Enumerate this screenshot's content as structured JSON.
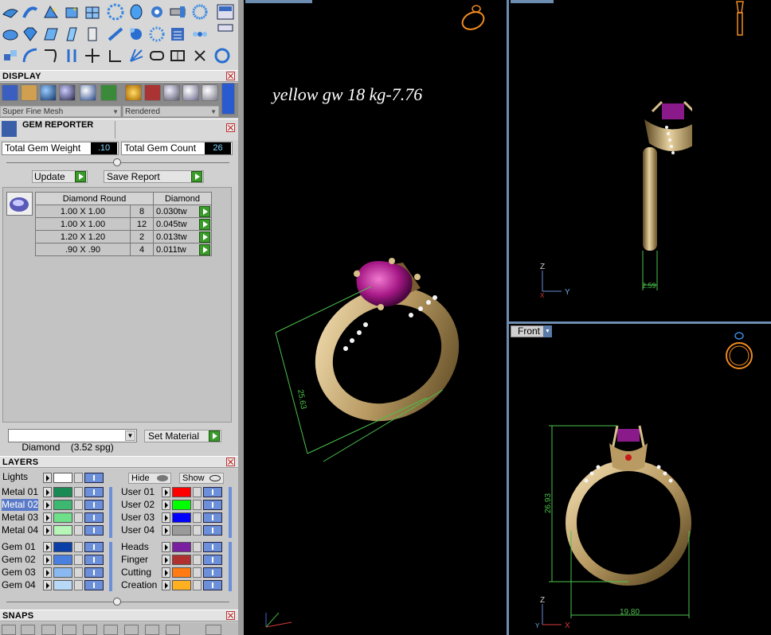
{
  "display": {
    "title": "DISPLAY",
    "mesh_mode": "Super Fine Mesh",
    "render_mode": "Rendered"
  },
  "gem_reporter": {
    "title": "GEM REPORTER",
    "total_weight_label": "Total Gem Weight",
    "total_weight_value": ".10",
    "total_count_label": "Total Gem Count",
    "total_count_value": "26",
    "update_label": "Update",
    "save_report_label": "Save Report",
    "table_headers": [
      "Diamond Round",
      "Diamond"
    ],
    "rows": [
      {
        "size": "1.00 X 1.00",
        "count": "8",
        "weight": "0.030tw"
      },
      {
        "size": "1.00 X 1.00",
        "count": "12",
        "weight": "0.045tw"
      },
      {
        "size": "1.20 X 1.20",
        "count": "2",
        "weight": "0.013tw"
      },
      {
        "size": ".90 X .90",
        "count": "4",
        "weight": "0.011tw"
      }
    ],
    "material_select": "Diamond    (3.52 spg)",
    "set_material_label": "Set Material"
  },
  "layers": {
    "title": "LAYERS",
    "lights_label": "Lights",
    "hide_label": "Hide",
    "show_label": "Show",
    "left": [
      {
        "label": "Metal 01",
        "color": "#1a8a55"
      },
      {
        "label": "Metal 02",
        "color": "#3db870"
      },
      {
        "label": "Metal 03",
        "color": "#6fe08a"
      },
      {
        "label": "Metal 04",
        "color": "#b8f5b8"
      },
      {
        "label": "Gem 01",
        "color": "#0b3fa8"
      },
      {
        "label": "Gem 02",
        "color": "#4a7fe0"
      },
      {
        "label": "Gem 03",
        "color": "#8ab8f0"
      },
      {
        "label": "Gem 04",
        "color": "#b8d8f8"
      }
    ],
    "right": [
      {
        "label": "User 01",
        "color": "#ff0000"
      },
      {
        "label": "User 02",
        "color": "#00ff00"
      },
      {
        "label": "User 03",
        "color": "#0000ff"
      },
      {
        "label": "User 04",
        "color": "#9a9a9a"
      },
      {
        "label": "Heads",
        "color": "#7a1fa0"
      },
      {
        "label": "Finger",
        "color": "#b03030"
      },
      {
        "label": "Cutting",
        "color": "#ff7a10"
      },
      {
        "label": "Creation",
        "color": "#ffb020"
      }
    ]
  },
  "snaps": {
    "title": "SNAPS"
  },
  "viewport_main": {
    "caption": "yellow gw 18 kg-7.76",
    "dimension": "25.63"
  },
  "viewport_side": {
    "dimension": "2.59",
    "axis_z": "Z",
    "axis_y": "Y",
    "axis_x": "X"
  },
  "viewport_front": {
    "view_label": "Front",
    "dim_height": "26.93",
    "dim_width": "19.80",
    "axis_z": "Z",
    "axis_y": "Y",
    "axis_x": "X"
  }
}
